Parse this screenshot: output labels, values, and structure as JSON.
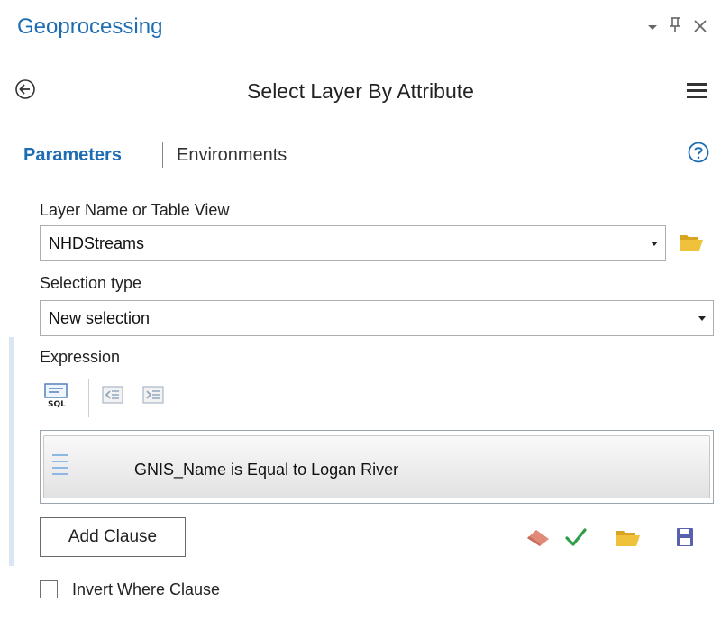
{
  "panel": {
    "title": "Geoprocessing",
    "controls": {
      "dropdown_icon": "chevron-down-icon",
      "pin_icon": "pin-icon",
      "close_icon": "close-icon"
    }
  },
  "tool": {
    "title": "Select Layer By Attribute",
    "back_icon": "back-arrow-icon",
    "menu_icon": "hamburger-menu-icon"
  },
  "tabs": {
    "parameters": "Parameters",
    "environments": "Environments",
    "help_icon": "help-icon"
  },
  "params": {
    "layer_label": "Layer Name or Table View",
    "layer_value": "NHDStreams",
    "selection_type_label": "Selection type",
    "selection_type_value": "New selection",
    "expression_label": "Expression"
  },
  "expression": {
    "sql_label": "SQL",
    "clause": "GNIS_Name  is Equal to  Logan River",
    "add_clause_label": "Add Clause"
  },
  "options": {
    "invert_where_label": "Invert Where Clause",
    "invert_where_checked": false
  },
  "colors": {
    "accent_blue": "#1e6db3",
    "check_green": "#2e9e46",
    "folder_yellow": "#f0c23b",
    "save_purple": "#5860b0",
    "eraser_red": "#e08a78"
  }
}
